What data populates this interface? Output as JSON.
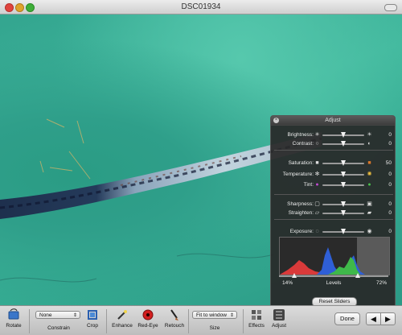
{
  "window": {
    "title": "DSC01934"
  },
  "panel": {
    "title": "Adjust",
    "sliders": [
      {
        "label": "Brightness:",
        "value": "0",
        "level": 0.5,
        "left_icon": "sun-small-icon",
        "right_icon": "sun-large-icon"
      },
      {
        "label": "Contrast:",
        "value": "0",
        "level": 0.5,
        "left_icon": "circle-outline-icon",
        "right_icon": "half-circle-icon"
      },
      {
        "label": "Saturation:",
        "value": "50",
        "level": 0.5,
        "left_icon": "grey-square-icon",
        "right_icon": "color-square-icon"
      },
      {
        "label": "Temperature:",
        "value": "0",
        "level": 0.5,
        "left_icon": "snowflake-icon",
        "right_icon": "sun-warm-icon"
      },
      {
        "label": "Tint:",
        "value": "0",
        "level": 0.5,
        "left_icon": "magenta-dot-icon",
        "right_icon": "green-dot-icon"
      },
      {
        "label": "Sharpness:",
        "value": "0",
        "level": 0.5,
        "left_icon": "soft-square-icon",
        "right_icon": "sharp-square-icon"
      },
      {
        "label": "Straighten:",
        "value": "0",
        "level": 0.5,
        "left_icon": "tilt-left-icon",
        "right_icon": "tilt-right-icon"
      },
      {
        "label": "Exposure:",
        "value": "0",
        "level": 0.5,
        "left_icon": "aperture-small-icon",
        "right_icon": "aperture-large-icon"
      }
    ],
    "levels": {
      "label": "Levels",
      "low": "14%",
      "high": "72%",
      "low_level": 0.14,
      "high_level": 0.72
    },
    "reset_label": "Reset Sliders"
  },
  "toolbar": {
    "rotate": "Rotate",
    "constrain_value": "None",
    "constrain": "Constrain",
    "crop": "Crop",
    "enhance": "Enhance",
    "redeye": "Red-Eye",
    "retouch": "Retouch",
    "size_value": "Fit to window",
    "size": "Size",
    "effects": "Effects",
    "adjust": "Adjust",
    "done": "Done",
    "prev": "◀",
    "next": "▶"
  }
}
